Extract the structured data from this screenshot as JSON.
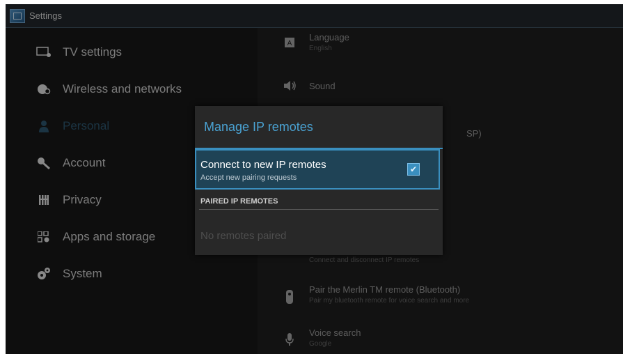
{
  "window": {
    "title": "Settings"
  },
  "sidebar": {
    "items": [
      {
        "label": "TV settings",
        "icon": "tv-settings-icon"
      },
      {
        "label": "Wireless and networks",
        "icon": "network-icon"
      },
      {
        "label": "Personal",
        "icon": "person-icon",
        "selected": true
      },
      {
        "label": "Account",
        "icon": "key-icon"
      },
      {
        "label": "Privacy",
        "icon": "privacy-icon"
      },
      {
        "label": "Apps and storage",
        "icon": "apps-icon"
      },
      {
        "label": "System",
        "icon": "gears-icon"
      }
    ]
  },
  "details": {
    "language": {
      "title": "Language",
      "subtitle": "English",
      "icon": "language-icon"
    },
    "sound": {
      "title": "Sound",
      "icon": "speaker-icon"
    },
    "hidden_row_fragment": "SP)",
    "ip_remotes_sub": "Connect and disconnect IP remotes",
    "merlin": {
      "title": "Pair the Merlin TM remote (Bluetooth)",
      "subtitle": "Pair my bluetooth remote for voice search and more",
      "icon": "remote-icon"
    },
    "voice": {
      "title": "Voice search",
      "subtitle": "Google",
      "icon": "microphone-icon"
    }
  },
  "dialog": {
    "title": "Manage IP remotes",
    "connect": {
      "title": "Connect to new IP remotes",
      "subtitle": "Accept new pairing requests",
      "checked": true
    },
    "paired_header": "PAIRED IP REMOTES",
    "empty_text": "No remotes paired"
  },
  "colors": {
    "accent": "#3a8fbf",
    "dialog_title": "#4aa2d2",
    "selected_row": "#1f4356"
  }
}
